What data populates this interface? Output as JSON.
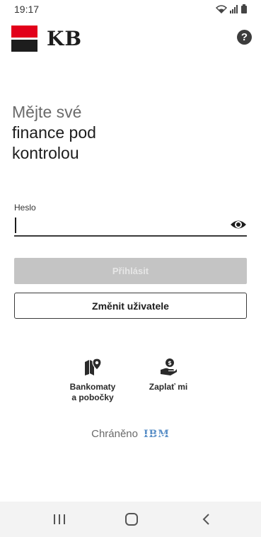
{
  "status_bar": {
    "time": "19:17"
  },
  "header": {
    "logo_text": "KB",
    "help_label": "?"
  },
  "headline": {
    "line1": "Mějte své",
    "line2": "finance pod",
    "line3": "kontrolou"
  },
  "login_form": {
    "password_label": "Heslo",
    "login_button": "Přihlásit",
    "change_user_button": "Změnit uživatele"
  },
  "quick_actions": [
    {
      "label_line1": "Bankomaty",
      "label_line2": "a pobočky",
      "icon": "map-pin-icon"
    },
    {
      "label_line1": "Zaplať mi",
      "label_line2": "",
      "icon": "hand-money-icon"
    }
  ],
  "footer": {
    "protected_text": "Chráněno",
    "partner_logo": "IBM"
  },
  "colors": {
    "brand_red": "#e2001a",
    "brand_black": "#1d1d1d",
    "disabled_button": "#c4c4c4",
    "ibm_blue": "#5a8fc7"
  }
}
